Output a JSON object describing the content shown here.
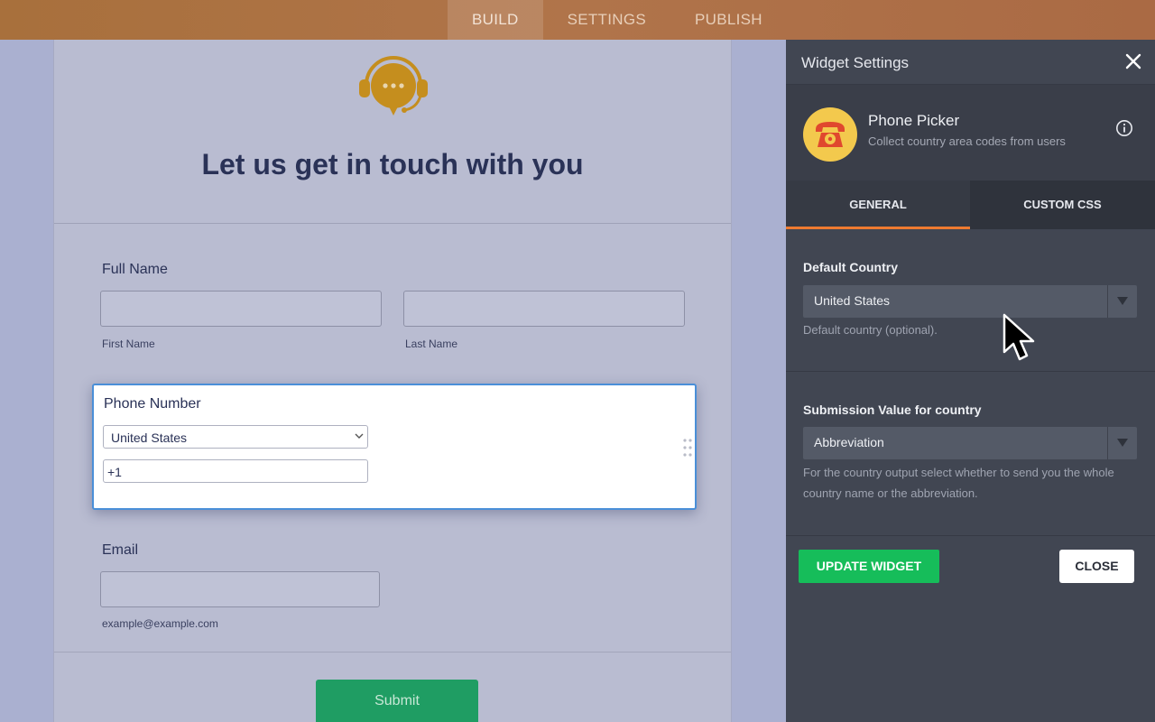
{
  "topnav": {
    "tabs": [
      {
        "label": "BUILD",
        "active": true
      },
      {
        "label": "SETTINGS"
      },
      {
        "label": "PUBLISH"
      }
    ]
  },
  "form": {
    "logo_icon": "chat-headset-icon",
    "title": "Let us get in touch with you",
    "full_name": {
      "label": "Full Name",
      "first_value": "",
      "first_sublabel": "First Name",
      "last_value": "",
      "last_sublabel": "Last Name"
    },
    "phone": {
      "label": "Phone Number",
      "country_value": "United States",
      "number_value": "+1"
    },
    "email": {
      "label": "Email",
      "value": "",
      "sublabel": "example@example.com"
    },
    "submit_label": "Submit"
  },
  "panel": {
    "title": "Widget Settings",
    "widget": {
      "name": "Phone Picker",
      "description": "Collect country area codes from users",
      "icon": "telephone-icon"
    },
    "tabs": {
      "general": "GENERAL",
      "custom_css": "CUSTOM CSS"
    },
    "default_country": {
      "label": "Default Country",
      "value": "United States",
      "help": "Default country (optional)."
    },
    "submission_value": {
      "label": "Submission Value for country",
      "value": "Abbreviation",
      "help": "For the country output select whether to send you the whole country name or the abbreviation."
    },
    "update_label": "UPDATE WIDGET",
    "close_label": "CLOSE"
  },
  "colors": {
    "accent_orange": "#ee7a30",
    "update_green": "#16bd5a",
    "submit_green": "#1f9d63",
    "title_navy": "#2a3257"
  }
}
